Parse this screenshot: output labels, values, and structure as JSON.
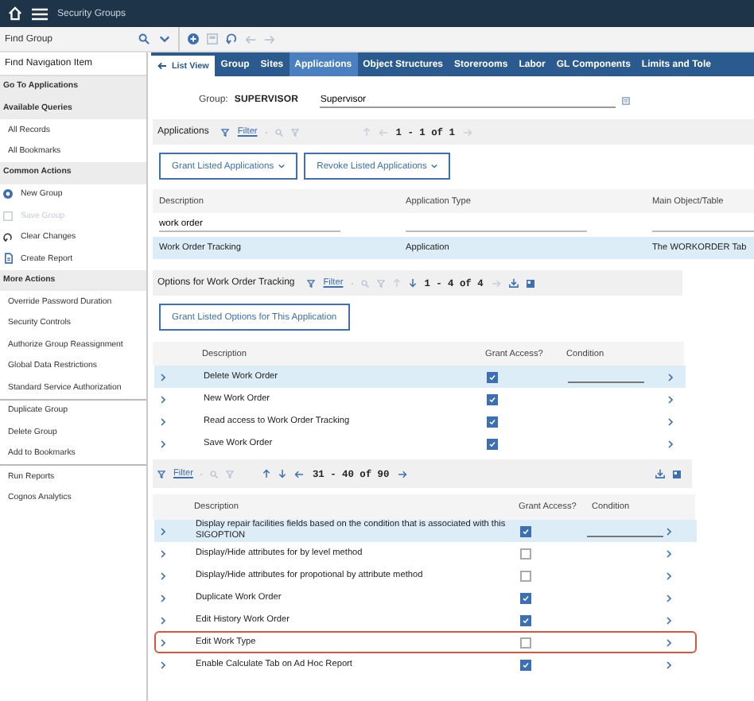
{
  "header": {
    "title": "Security Groups"
  },
  "toolbar": {
    "find_field": {
      "placeholder": "Find Group"
    }
  },
  "sidebar": {
    "search": {
      "placeholder": "Find Navigation Item"
    },
    "sections": [
      {
        "heading": "Go To Applications"
      },
      {
        "heading": "Available Queries",
        "items": [
          {
            "kind": "link",
            "label": "All Records",
            "disabled": false
          },
          {
            "kind": "link",
            "label": "All Bookmarks",
            "disabled": false
          }
        ]
      },
      {
        "heading": "Common Actions",
        "items": [
          {
            "kind": "new",
            "label": "New Group",
            "disabled": false
          },
          {
            "kind": "save",
            "label": "Save Group",
            "disabled": true
          },
          {
            "kind": "undo",
            "label": "Clear Changes",
            "disabled": false
          },
          {
            "kind": "report",
            "label": "Create Report",
            "disabled": false
          }
        ]
      },
      {
        "heading": "More Actions",
        "items": [
          {
            "kind": "link",
            "label": "Override Password Duration",
            "disabled": false
          },
          {
            "kind": "link",
            "label": "Security Controls",
            "disabled": false
          },
          {
            "kind": "link",
            "label": "Authorize Group Reassignment",
            "disabled": false
          },
          {
            "kind": "link",
            "label": "Global Data Restrictions",
            "disabled": false
          },
          {
            "kind": "link",
            "label": "Standard Service Authorization",
            "disabled": false
          }
        ]
      },
      {
        "items": [
          {
            "kind": "link",
            "label": "Duplicate Group",
            "disabled": false
          },
          {
            "kind": "link",
            "label": "Delete Group",
            "disabled": false
          },
          {
            "kind": "link",
            "label": "Add to Bookmarks",
            "disabled": false
          }
        ]
      },
      {
        "items": [
          {
            "kind": "link",
            "label": "Run Reports",
            "disabled": false
          },
          {
            "kind": "link",
            "label": "Cognos Analytics",
            "disabled": false
          }
        ]
      }
    ]
  },
  "back_link": {
    "label": "List View"
  },
  "tabs": [
    {
      "label": "Group",
      "selected": false
    },
    {
      "label": "Sites",
      "selected": false
    },
    {
      "label": "Applications",
      "selected": true
    },
    {
      "label": "Object Structures",
      "selected": false
    },
    {
      "label": "Storerooms",
      "selected": false
    },
    {
      "label": "Labor",
      "selected": false
    },
    {
      "label": "GL Components",
      "selected": false
    },
    {
      "label": "Limits and Tole",
      "selected": false
    }
  ],
  "group": {
    "label": "Group:",
    "value": "SUPERVISOR",
    "description": "Supervisor"
  },
  "applications": {
    "title": "Applications",
    "filter_label": "Filter",
    "pagination": "1 - 1 of 1",
    "buttons": [
      "Grant Listed Applications",
      "Revoke Listed Applications"
    ],
    "columns": [
      "Description",
      "Application Type",
      "Main Object/Table"
    ],
    "filter_value": "work order",
    "rows": [
      {
        "cells": [
          "Work Order Tracking",
          "Application",
          "The WORKORDER Tab"
        ],
        "selected": true
      }
    ]
  },
  "options": {
    "title": "Options for Work Order Tracking",
    "filter_label": "Filter",
    "pagination": "1 - 4 of 4",
    "button": "Grant Listed Options for This Application",
    "columns": [
      "Description",
      "Grant Access?",
      "Condition"
    ],
    "rows": [
      {
        "description": "Delete Work Order",
        "granted": true,
        "selected": true
      },
      {
        "description": "New Work Order",
        "granted": true,
        "selected": false
      },
      {
        "description": "Read access to Work Order Tracking",
        "granted": true,
        "selected": false
      },
      {
        "description": "Save Work Order",
        "granted": true,
        "selected": false
      }
    ]
  },
  "all_options": {
    "filter_label": "Filter",
    "pagination": "31 - 40 of 90",
    "columns": [
      "Description",
      "Grant Access?",
      "Condition"
    ],
    "rows": [
      {
        "description": "Display repair facilities fields based on the condition that is associated with this SIGOPTION",
        "granted": true,
        "selected": true,
        "outlined": false
      },
      {
        "description": "Display/Hide attributes for by level method",
        "granted": false,
        "selected": false,
        "outlined": false
      },
      {
        "description": "Display/Hide attributes for propotional by attribute method",
        "granted": false,
        "selected": false,
        "outlined": false
      },
      {
        "description": "Duplicate Work Order",
        "granted": true,
        "selected": false,
        "outlined": false
      },
      {
        "description": "Edit History Work Order",
        "granted": true,
        "selected": false,
        "outlined": false
      },
      {
        "description": "Edit Work Type",
        "granted": false,
        "selected": false,
        "outlined": true
      },
      {
        "description": "Enable Calculate Tab on Ad Hoc Report",
        "granted": true,
        "selected": false,
        "outlined": false
      }
    ]
  }
}
